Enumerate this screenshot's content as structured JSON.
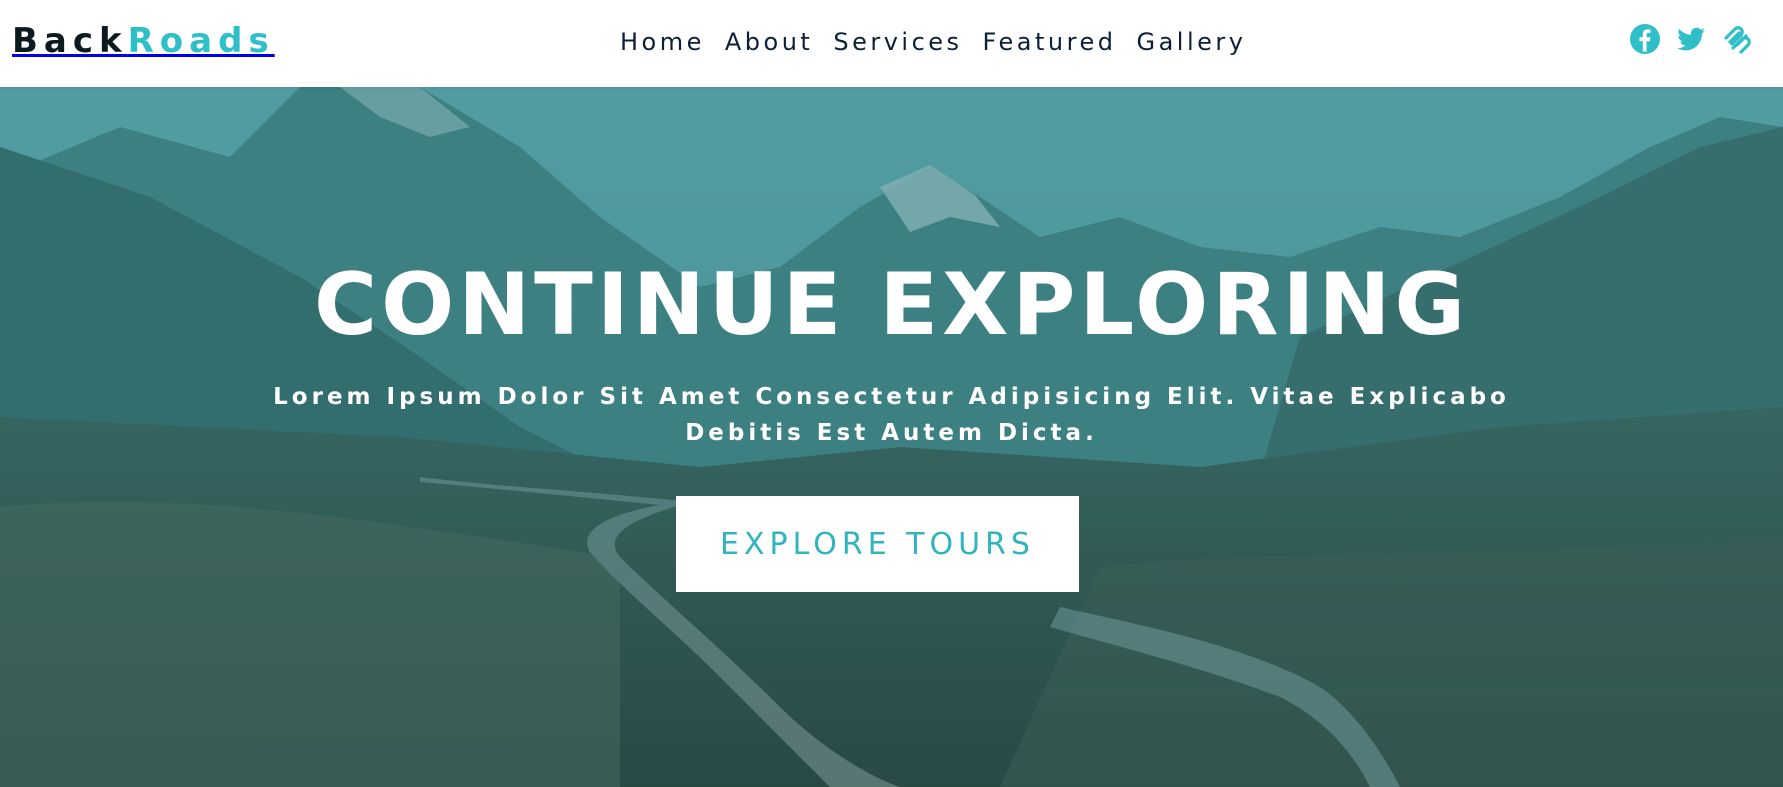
{
  "brand": {
    "part1": "Back",
    "part2": "Roads"
  },
  "nav": {
    "links": [
      "Home",
      "About",
      "Services",
      "Featured",
      "Gallery"
    ]
  },
  "social": [
    {
      "icon": "facebook-icon"
    },
    {
      "icon": "twitter-icon"
    },
    {
      "icon": "squarespace-icon"
    }
  ],
  "hero": {
    "title": "CONTINUE EXPLORING",
    "text_line1": "Lorem Ipsum Dolor Sit Amet Consectetur Adipisicing Elit. Vitae Explicabo",
    "text_line2": "Debitis Est Autem Dicta.",
    "button": "EXPLORE TOURS"
  },
  "colors": {
    "accent": "#2fbfc9",
    "nav_text": "#0c1f3a",
    "logo_dark": "#0c1a1f",
    "hero_tint": "#1e6e73",
    "button_bg": "#ffffff"
  }
}
